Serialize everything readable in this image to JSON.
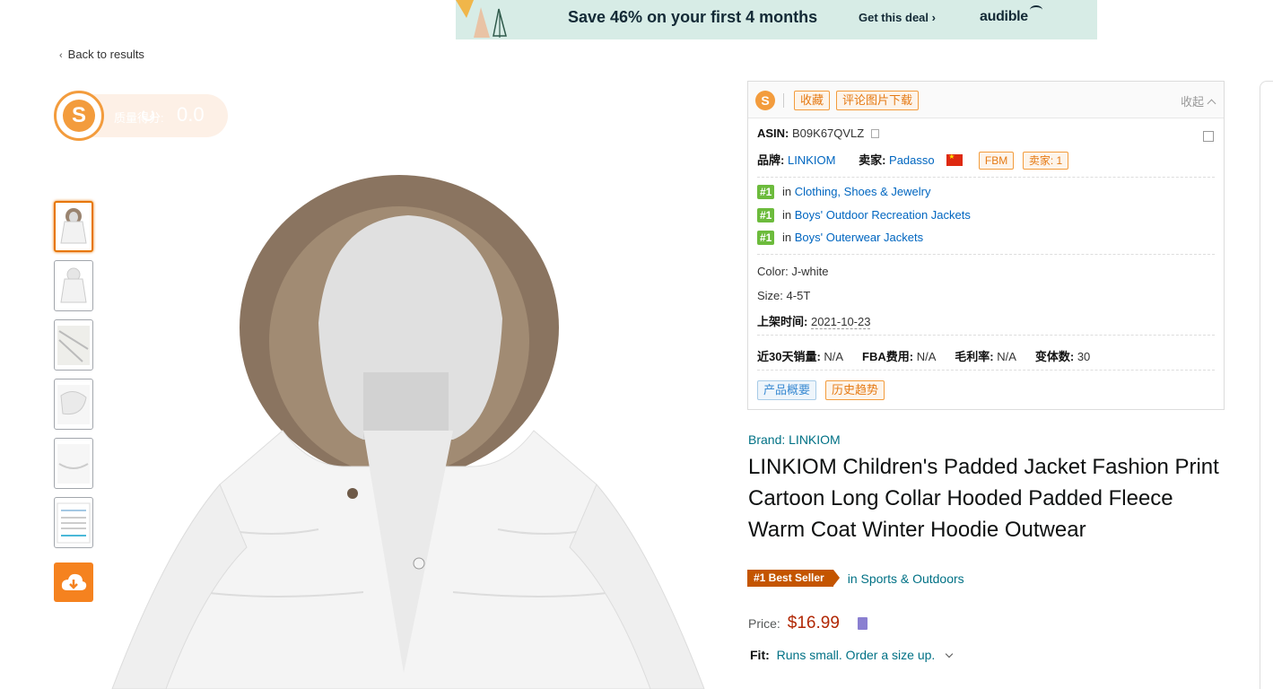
{
  "ad": {
    "headline": "Save 46% on your first 4 months",
    "cta": "Get this deal ›",
    "brand": "audible"
  },
  "nav": {
    "back_label": "Back to results"
  },
  "score_widget": {
    "label": "质量得分:",
    "value": "0.0"
  },
  "thumbnails": [
    {
      "icon": "jacket-front",
      "selected": true
    },
    {
      "icon": "jacket-back",
      "selected": false
    },
    {
      "icon": "fabric-detail",
      "selected": false
    },
    {
      "icon": "hood-detail",
      "selected": false
    },
    {
      "icon": "hem-detail",
      "selected": false
    },
    {
      "icon": "size-chart",
      "selected": false
    }
  ],
  "panel": {
    "buttons": {
      "favorite": "收藏",
      "download_review_images": "评论图片下载"
    },
    "collapse_label": "收起",
    "asin": {
      "label": "ASIN:",
      "value": "B09K67QVLZ"
    },
    "brand": {
      "label": "品牌:",
      "value": "LINKIOM"
    },
    "seller": {
      "label": "卖家:",
      "value": "Padasso",
      "fulfillment": "FBM",
      "seller_count": "卖家: 1"
    },
    "rankings": [
      {
        "rank": "#1",
        "prefix": "in",
        "category": "Clothing, Shoes & Jewelry"
      },
      {
        "rank": "#1",
        "prefix": "in",
        "category": "Boys' Outdoor Recreation Jackets"
      },
      {
        "rank": "#1",
        "prefix": "in",
        "category": "Boys' Outerwear Jackets"
      }
    ],
    "color": {
      "label": "Color:",
      "value": "J-white"
    },
    "size": {
      "label": "Size:",
      "value": "4-5T"
    },
    "listed": {
      "label": "上架时间:",
      "value": "2021-10-23"
    },
    "stats": {
      "sales_30d": {
        "label": "近30天销量:",
        "value": "N/A"
      },
      "fba_fee": {
        "label": "FBA费用:",
        "value": "N/A"
      },
      "margin": {
        "label": "毛利率:",
        "value": "N/A"
      },
      "variants": {
        "label": "变体数:",
        "value": "30"
      }
    },
    "tabs": {
      "overview": "产品概要",
      "history": "历史趋势"
    }
  },
  "product": {
    "brand_link": "Brand: LINKIOM",
    "title": "LINKIOM Children's Padded Jacket Fashion Print Cartoon Long Collar Hooded Padded Fleece Warm Coat Winter Hoodie Outwear",
    "best_seller_badge": "#1 Best Seller",
    "best_seller_category": "in Sports & Outdoors",
    "price_label": "Price:",
    "price": "$16.99",
    "fit_label": "Fit:",
    "fit_value": "Runs small. Order a size up."
  },
  "colors": {
    "accent_orange": "#f39c3d",
    "amazon_link": "#007185",
    "price_red": "#b12704",
    "best_seller": "#c45500",
    "rank_green": "#6cbb3c"
  }
}
